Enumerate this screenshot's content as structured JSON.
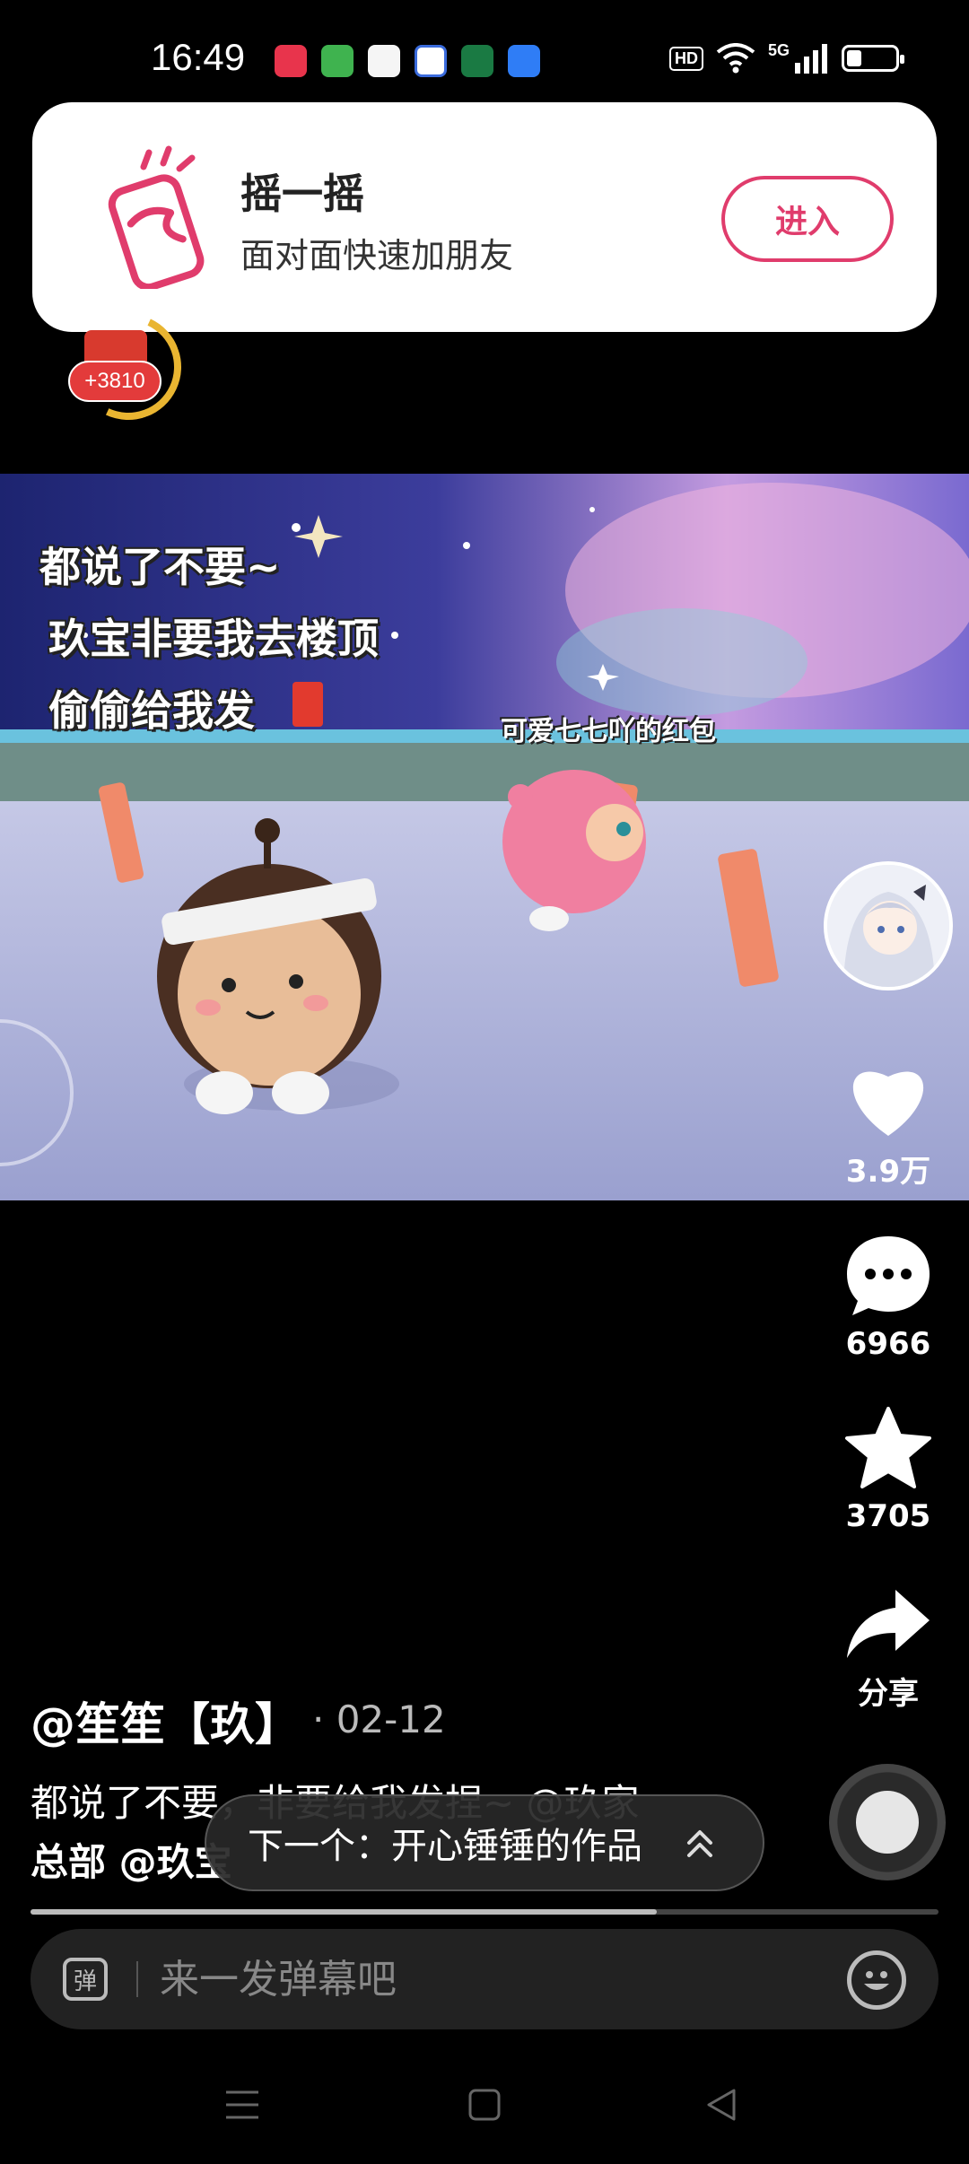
{
  "status_bar": {
    "time": "16:49",
    "notification_icons": [
      "app-icon-1",
      "app-icon-2",
      "app-icon-3",
      "app-icon-4",
      "app-icon-5",
      "app-icon-6"
    ],
    "hd_label": "HD",
    "network_label": "5G",
    "icons": [
      "wifi-icon",
      "signal-icon",
      "battery-icon"
    ]
  },
  "notification": {
    "title": "摇一摇",
    "subtitle": "面对面快速加朋友",
    "enter_label": "进入",
    "accent_color": "#e03c6c"
  },
  "red_packet": {
    "amount": "+3810"
  },
  "video": {
    "captions": [
      "都说了不要~",
      "玖宝非要我去楼顶",
      "偷偷给我发"
    ],
    "inline_label": "可爱七七吖的红包"
  },
  "actions": {
    "like_count": "3.9万",
    "comment_count": "6966",
    "favorite_count": "3705",
    "share_label": "分享"
  },
  "post": {
    "author": "@笙笙【玖】",
    "date": "· 02-12",
    "caption_line1": "都说了不要，非要给我发捏~ @玖家",
    "caption_line2": "总部 @玖宝"
  },
  "next_video": {
    "label": "下一个：开心锤锤的作品"
  },
  "playback": {
    "progress": 0.69
  },
  "danmaku": {
    "icon_glyph": "弹",
    "placeholder": "来一发弹幕吧"
  }
}
